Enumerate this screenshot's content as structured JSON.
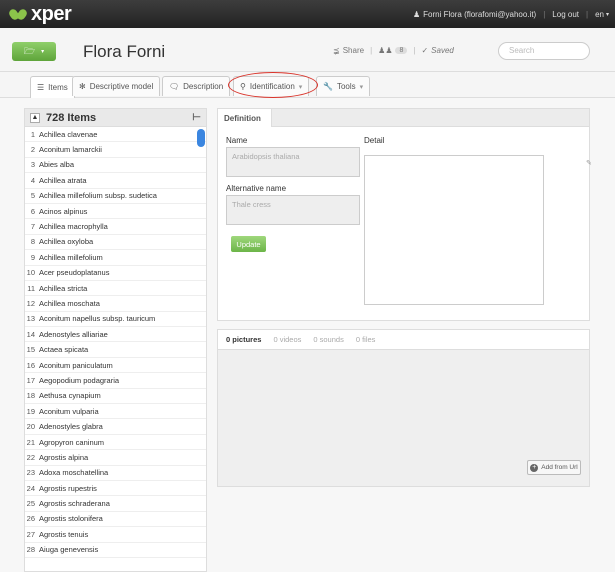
{
  "topbar": {
    "logo": "xper",
    "user": "Forni Flora (florafomi@yahoo.it)",
    "logout": "Log out",
    "lang": "en"
  },
  "header": {
    "title": "Flora Forni",
    "share": "Share",
    "members_count": "8",
    "saved": "Saved",
    "search_placeholder": "Search"
  },
  "tabs": {
    "items": "Items",
    "descriptive_model": "Descriptive model",
    "description": "Description",
    "identification": "Identification",
    "tools": "Tools"
  },
  "list": {
    "count_label": "728 Items",
    "items": [
      {
        "n": "1",
        "name": "Achillea clavenae"
      },
      {
        "n": "2",
        "name": "Aconitum lamarckii"
      },
      {
        "n": "3",
        "name": "Abies alba"
      },
      {
        "n": "4",
        "name": "Achillea atrata"
      },
      {
        "n": "5",
        "name": "Achillea millefolium subsp. sudetica"
      },
      {
        "n": "6",
        "name": "Acinos alpinus"
      },
      {
        "n": "7",
        "name": "Achillea macrophylla"
      },
      {
        "n": "8",
        "name": "Achillea oxyloba"
      },
      {
        "n": "9",
        "name": "Achillea millefolium"
      },
      {
        "n": "10",
        "name": "Acer pseudoplatanus"
      },
      {
        "n": "11",
        "name": "Achillea stricta"
      },
      {
        "n": "12",
        "name": "Achillea moschata"
      },
      {
        "n": "13",
        "name": "Aconitum napellus subsp. tauricum"
      },
      {
        "n": "14",
        "name": "Adenostyles alliariae"
      },
      {
        "n": "15",
        "name": "Actaea spicata"
      },
      {
        "n": "16",
        "name": "Aconitum paniculatum"
      },
      {
        "n": "17",
        "name": "Aegopodium podagraria"
      },
      {
        "n": "18",
        "name": "Aethusa cynapium"
      },
      {
        "n": "19",
        "name": "Aconitum vulparia"
      },
      {
        "n": "20",
        "name": "Adenostyles glabra"
      },
      {
        "n": "21",
        "name": "Agropyron caninum"
      },
      {
        "n": "22",
        "name": "Agrostis alpina"
      },
      {
        "n": "23",
        "name": "Adoxa moschatellina"
      },
      {
        "n": "24",
        "name": "Agrostis rupestris"
      },
      {
        "n": "25",
        "name": "Agrostis schraderana"
      },
      {
        "n": "26",
        "name": "Agrostis stolonifera"
      },
      {
        "n": "27",
        "name": "Agrostis tenuis"
      },
      {
        "n": "28",
        "name": "Aiuga genevensis"
      }
    ]
  },
  "definition": {
    "tab": "Definition",
    "name_label": "Name",
    "name_value": "Arabidopsis thaliana",
    "alt_label": "Alternative name",
    "alt_value": "Thale cress",
    "detail_label": "Detail",
    "update": "Update"
  },
  "media": {
    "pictures": "0 pictures",
    "videos": "0 videos",
    "sounds": "0 sounds",
    "files": "0 files",
    "add_url": "Add from Url"
  }
}
